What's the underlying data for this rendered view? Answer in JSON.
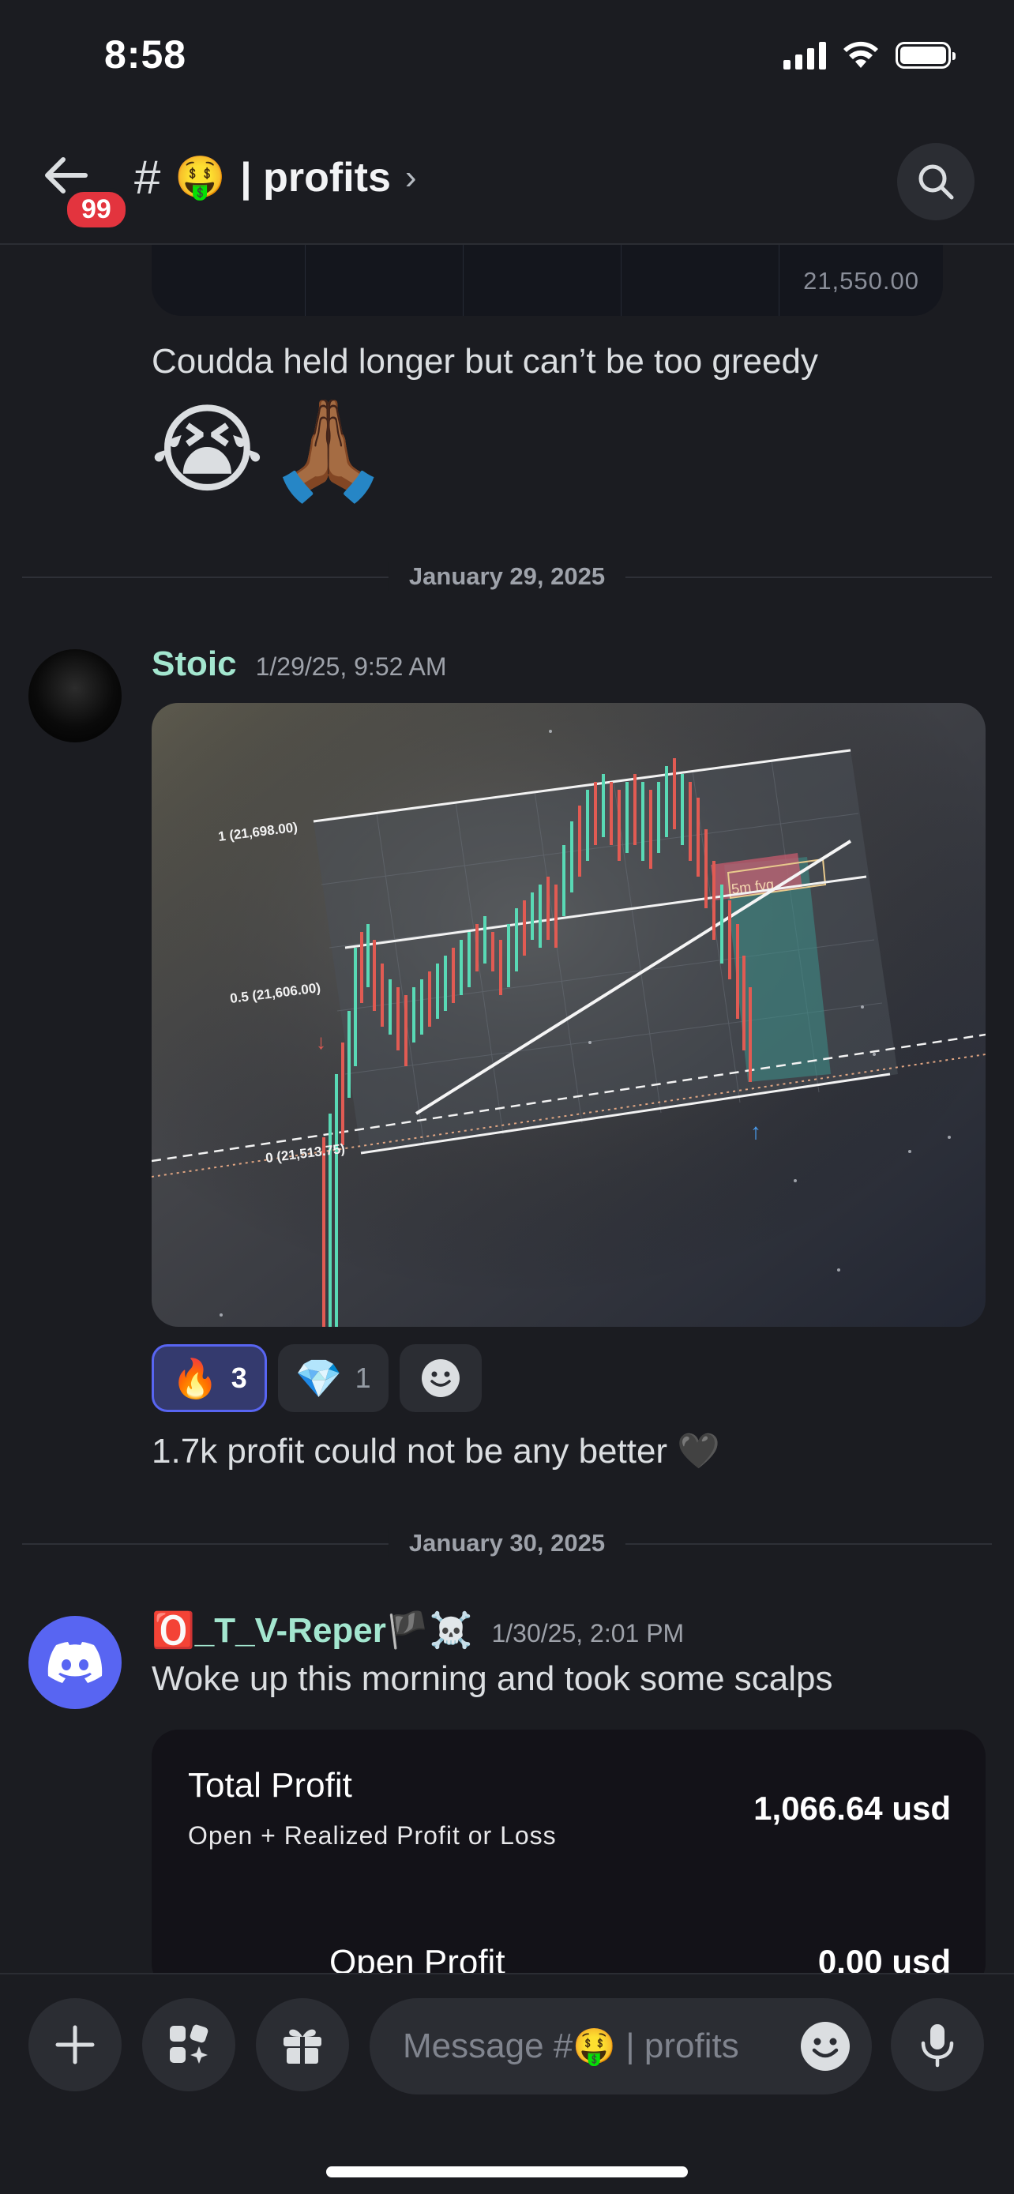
{
  "status_bar": {
    "time": "8:58"
  },
  "header": {
    "unread_count": "99",
    "channel_hash": "#",
    "channel_emoji": "🤑",
    "channel_name": "| profits",
    "chevron": "›"
  },
  "chat": {
    "prev_chart_price": "21,550.00",
    "messages": [
      {
        "text": "Coudda held longer but can’t be too greedy",
        "emoji": "😭🙏🏾"
      }
    ],
    "date_divider_1": "January 29, 2025",
    "post_stoic": {
      "author": "Stoic",
      "timestamp": "1/29/25, 9:52 AM",
      "chart_labels": {
        "level_1": "1 (21,698.00)",
        "level_05": "0.5 (21,606.00)",
        "level_0": "0 (21,513.75)",
        "box": "5m fvg"
      },
      "reactions": [
        {
          "emoji": "🔥",
          "count": "3",
          "active": true
        },
        {
          "emoji": "💎",
          "count": "1",
          "active": false
        }
      ],
      "text": "1.7k profit could not be any better 🖤"
    },
    "date_divider_2": "January 30, 2025",
    "post_reper": {
      "author": "🅾️_T_V-Reper🏴☠️",
      "timestamp": "1/30/25, 2:01 PM",
      "text": "Woke up this morning and took some scalps",
      "card": {
        "title": "Total Profit",
        "subtitle": "Open + Realized Profit or Loss",
        "value": "1,066.64 usd",
        "open_label": "Open Profit",
        "open_value": "0.00 usd"
      }
    }
  },
  "composer": {
    "placeholder_prefix": "Message #",
    "placeholder_emoji": "🤑",
    "placeholder_suffix": " | profits"
  },
  "colors": {
    "background": "#1b1c21",
    "username_green": "#a3e6cf",
    "badge_red": "#e3343e",
    "blurple": "#5865f2"
  },
  "icons": [
    "back-arrow-icon",
    "search-icon",
    "plus-icon",
    "apps-icon",
    "gift-icon",
    "emoji-icon",
    "microphone-icon",
    "discord-logo-icon"
  ]
}
